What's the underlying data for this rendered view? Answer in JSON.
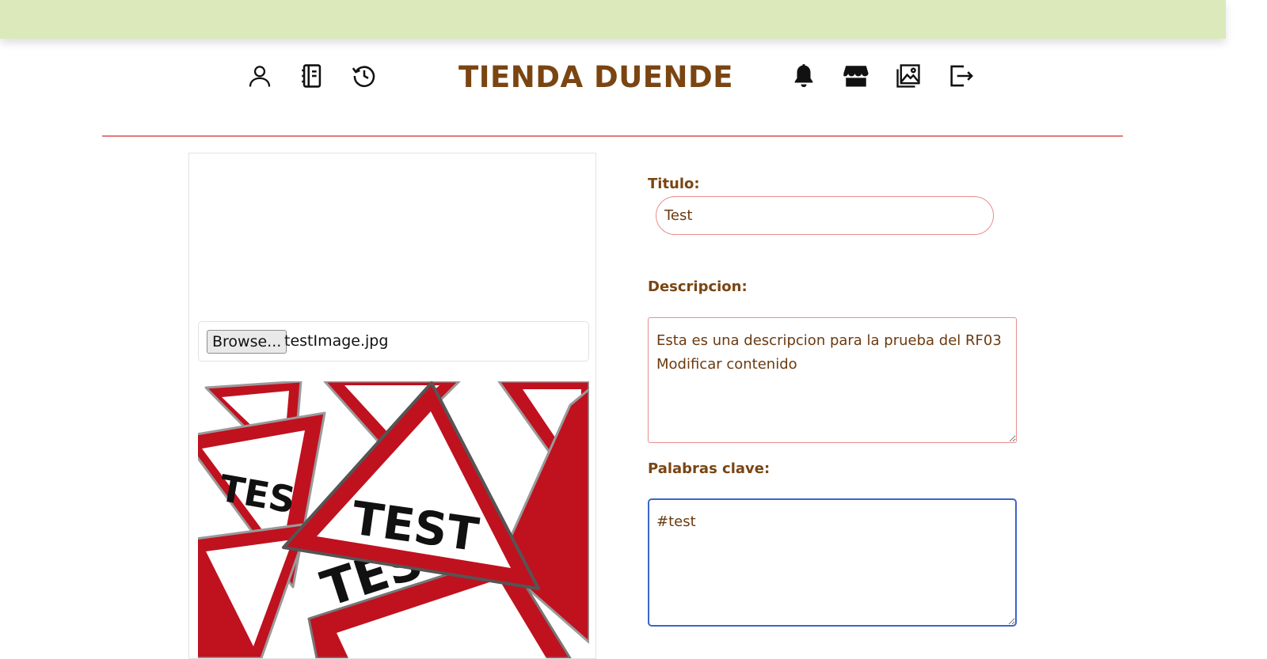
{
  "header": {
    "brand": "TIENDA DUENDE",
    "nav_left": [
      {
        "icon": "user-icon"
      },
      {
        "icon": "notebook-icon"
      },
      {
        "icon": "history-icon"
      }
    ],
    "nav_right": [
      {
        "icon": "bell-icon"
      },
      {
        "icon": "store-icon"
      },
      {
        "icon": "image-gallery-icon"
      },
      {
        "icon": "logout-icon"
      }
    ]
  },
  "upload": {
    "browse_label": "Browse...",
    "file_name": "testImage.jpg",
    "preview_text": "TEST"
  },
  "form": {
    "title_label": "Titulo:",
    "title_value": "Test",
    "description_label": "Descripcion:",
    "description_value": "Esta es una descripcion para la prueba del RF03 Modificar contenido",
    "keywords_label": "Palabras clave:",
    "keywords_value": "#test"
  },
  "colors": {
    "topbar": "#dbe9bb",
    "brand": "#7a4512",
    "divider": "#e57a7a",
    "focus": "#3b66c8",
    "sign_red": "#c0111f"
  }
}
